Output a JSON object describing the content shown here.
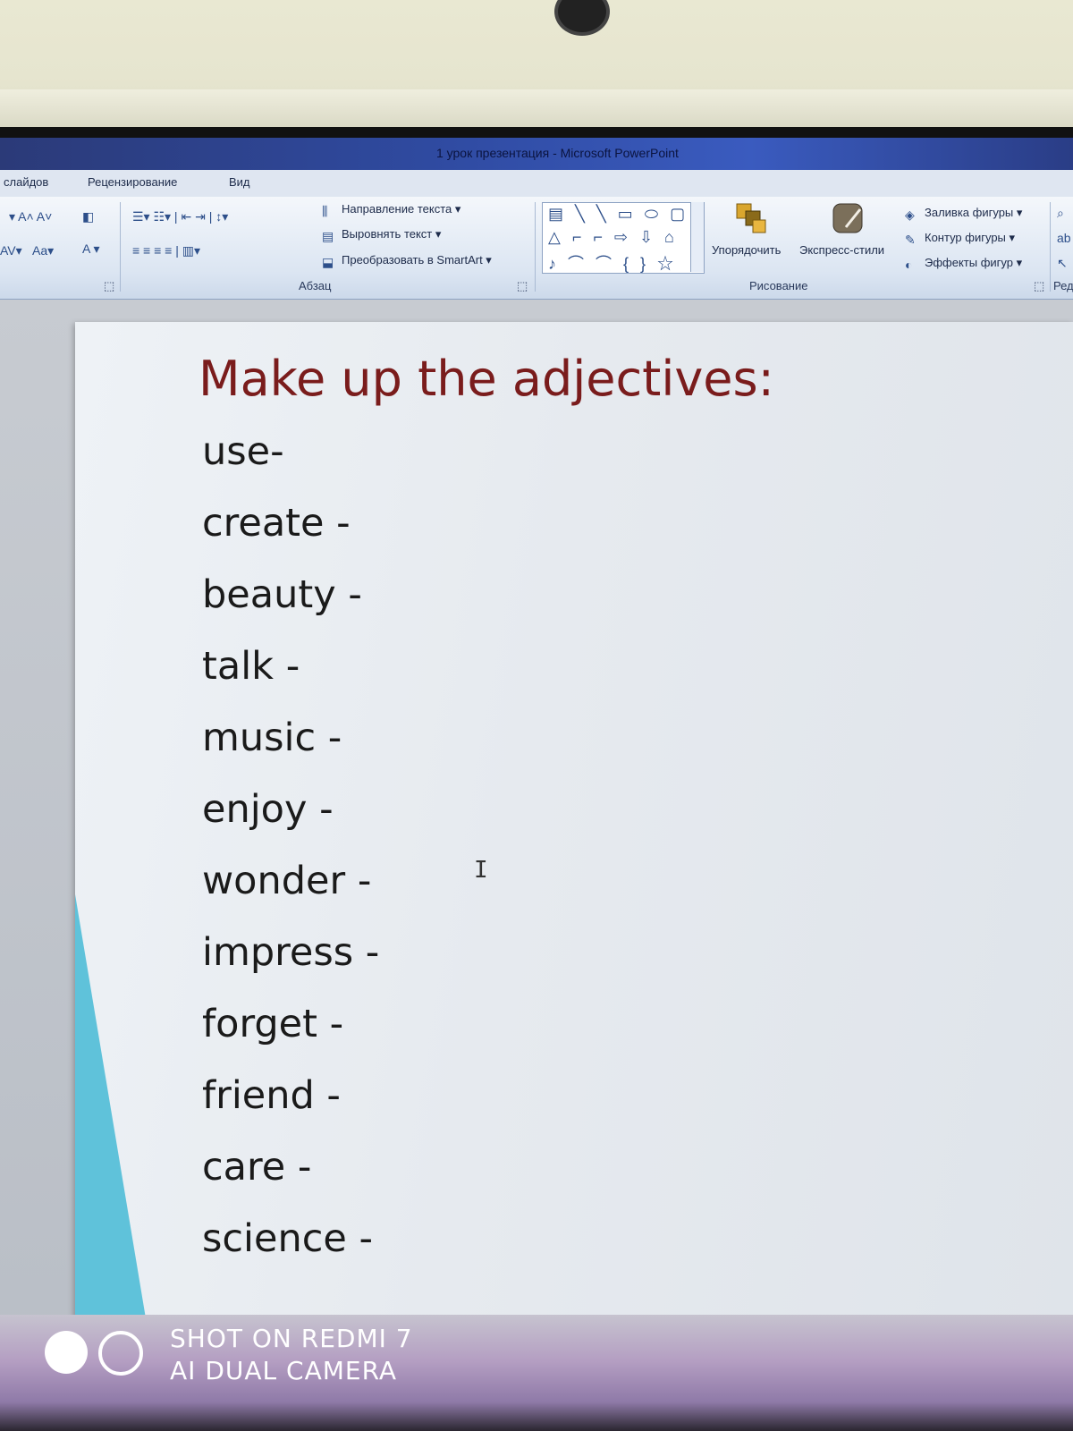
{
  "window": {
    "title": "1 урок презентация - Microsoft PowerPoint"
  },
  "ribbon": {
    "tabs": [
      "слайдов",
      "Рецензирование",
      "Вид"
    ],
    "paragraph_group": {
      "label": "Абзац",
      "text_direction": "Направление текста",
      "align_text": "Выровнять текст",
      "convert_smartart": "Преобразовать в SmartArt"
    },
    "drawing_group": {
      "label": "Рисование",
      "arrange": "Упорядочить",
      "quick_styles": "Экспресс-стили",
      "shape_fill": "Заливка фигуры",
      "shape_outline": "Контур фигуры",
      "shape_effects": "Эффекты фигур"
    },
    "editing_group_label": "Редакт"
  },
  "slide": {
    "title": "Make up the adjectives:",
    "words": [
      "use-",
      "create  -",
      "beauty  -",
      "talk  -",
      "music  -",
      "enjoy  -",
      "wonder  -",
      "impress  -",
      "forget  -",
      "friend  -",
      "care  -",
      "science  -"
    ]
  },
  "colors": {
    "title_red": "#7a1c1c",
    "slide_accent_teal": "#5fc2da",
    "ribbon_blue": "#dbe5f2"
  },
  "watermark": {
    "line1": "SHOT ON REDMI 7",
    "line2": "AI DUAL CAMERA"
  }
}
